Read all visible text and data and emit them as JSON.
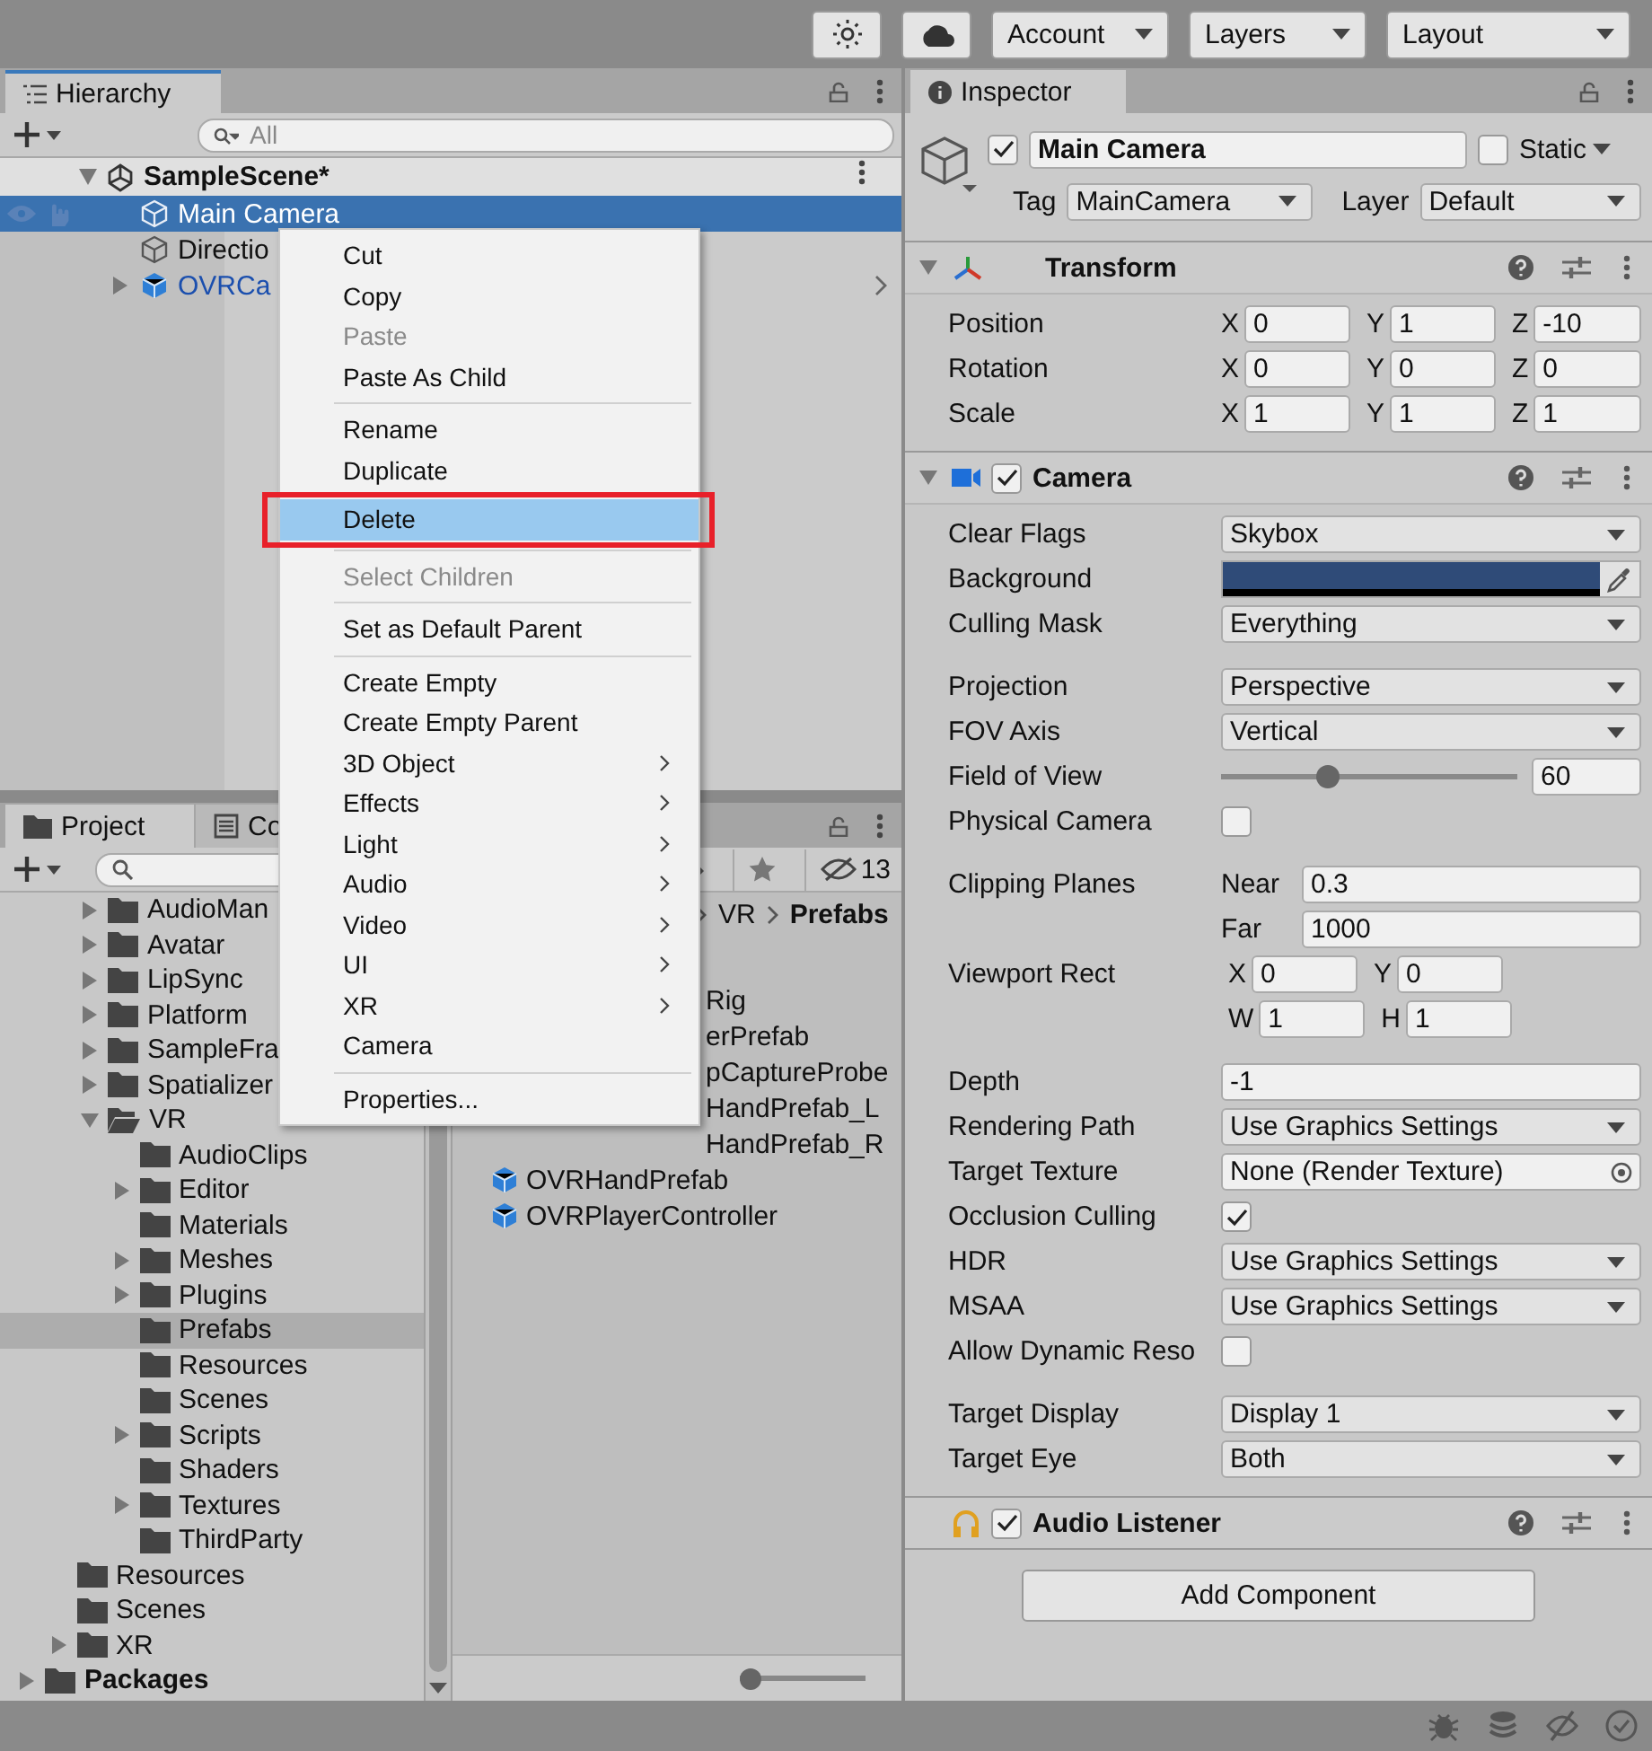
{
  "toolbar": {
    "dropdowns": [
      "Account",
      "Layers",
      "Layout"
    ]
  },
  "hierarchy": {
    "tab": "Hierarchy",
    "search_placeholder": "All",
    "scene": "SampleScene*",
    "items": [
      {
        "name": "Main Camera",
        "kind": "object",
        "selected": true,
        "expandable": false
      },
      {
        "name": "Directio",
        "kind": "object",
        "selected": false,
        "expandable": false
      },
      {
        "name": "OVRCa",
        "kind": "prefab",
        "selected": false,
        "expandable": true
      }
    ]
  },
  "context_menu": [
    [
      {
        "label": "Cut",
        "disabled": false,
        "submenu": false,
        "selected": false
      },
      {
        "label": "Copy",
        "disabled": false,
        "submenu": false,
        "selected": false
      },
      {
        "label": "Paste",
        "disabled": true,
        "submenu": false,
        "selected": false
      },
      {
        "label": "Paste As Child",
        "disabled": false,
        "submenu": false,
        "selected": false
      }
    ],
    [
      {
        "label": "Rename",
        "disabled": false,
        "submenu": false,
        "selected": false
      },
      {
        "label": "Duplicate",
        "disabled": false,
        "submenu": false,
        "selected": false
      },
      {
        "label": "Delete",
        "disabled": false,
        "submenu": false,
        "selected": true
      }
    ],
    [
      {
        "label": "Select Children",
        "disabled": true,
        "submenu": false,
        "selected": false
      }
    ],
    [
      {
        "label": "Set as Default Parent",
        "disabled": false,
        "submenu": false,
        "selected": false
      }
    ],
    [
      {
        "label": "Create Empty",
        "disabled": false,
        "submenu": false,
        "selected": false
      },
      {
        "label": "Create Empty Parent",
        "disabled": false,
        "submenu": false,
        "selected": false
      },
      {
        "label": "3D Object",
        "disabled": false,
        "submenu": true,
        "selected": false
      },
      {
        "label": "Effects",
        "disabled": false,
        "submenu": true,
        "selected": false
      },
      {
        "label": "Light",
        "disabled": false,
        "submenu": true,
        "selected": false
      },
      {
        "label": "Audio",
        "disabled": false,
        "submenu": true,
        "selected": false
      },
      {
        "label": "Video",
        "disabled": false,
        "submenu": true,
        "selected": false
      },
      {
        "label": "UI",
        "disabled": false,
        "submenu": true,
        "selected": false
      },
      {
        "label": "XR",
        "disabled": false,
        "submenu": true,
        "selected": false
      },
      {
        "label": "Camera",
        "disabled": false,
        "submenu": false,
        "selected": false
      }
    ],
    [
      {
        "label": "Properties...",
        "disabled": false,
        "submenu": false,
        "selected": false
      }
    ]
  ],
  "project": {
    "tabs": [
      {
        "label": "Project",
        "selected": true
      },
      {
        "label": "Co",
        "selected": false
      }
    ],
    "hidden_count": "13",
    "tree": [
      {
        "children": [
          {
            "children": [
              {
                "name": "AudioMan",
                "expandable": true,
                "expanded": false,
                "selected": false
              },
              {
                "name": "Avatar",
                "expandable": true,
                "expanded": false,
                "selected": false
              },
              {
                "name": "LipSync",
                "expandable": true,
                "expanded": false,
                "selected": false
              },
              {
                "name": "Platform",
                "expandable": true,
                "expanded": false,
                "selected": false
              },
              {
                "name": "SampleFra",
                "expandable": true,
                "expanded": false,
                "selected": false
              },
              {
                "name": "Spatializer",
                "expandable": true,
                "expanded": false,
                "selected": false
              },
              {
                "name": "VR",
                "expandable": true,
                "expanded": true,
                "selected": false,
                "children": [
                  {
                    "name": "AudioClips",
                    "expandable": false,
                    "expanded": false,
                    "selected": false
                  },
                  {
                    "name": "Editor",
                    "expandable": true,
                    "expanded": false,
                    "selected": false
                  },
                  {
                    "name": "Materials",
                    "expandable": false,
                    "expanded": false,
                    "selected": false
                  },
                  {
                    "name": "Meshes",
                    "expandable": true,
                    "expanded": false,
                    "selected": false
                  },
                  {
                    "name": "Plugins",
                    "expandable": true,
                    "expanded": false,
                    "selected": false
                  },
                  {
                    "name": "Prefabs",
                    "expandable": false,
                    "expanded": false,
                    "selected": true
                  },
                  {
                    "name": "Resources",
                    "expandable": false,
                    "expanded": false,
                    "selected": false
                  },
                  {
                    "name": "Scenes",
                    "expandable": false,
                    "expanded": false,
                    "selected": false
                  },
                  {
                    "name": "Scripts",
                    "expandable": true,
                    "expanded": false,
                    "selected": false
                  },
                  {
                    "name": "Shaders",
                    "expandable": false,
                    "expanded": false,
                    "selected": false
                  },
                  {
                    "name": "Textures",
                    "expandable": true,
                    "expanded": false,
                    "selected": false
                  },
                  {
                    "name": "ThirdParty",
                    "expandable": false,
                    "expanded": false,
                    "selected": false
                  }
                ]
              }
            ]
          },
          {
            "name": "Resources",
            "expandable": false,
            "expanded": false,
            "selected": false
          },
          {
            "name": "Scenes",
            "expandable": false,
            "expanded": false,
            "selected": false
          },
          {
            "name": "XR",
            "expandable": true,
            "expanded": false,
            "selected": false
          }
        ]
      },
      {
        "name": "Packages",
        "expandable": true,
        "expanded": false,
        "selected": false
      }
    ],
    "breadcrumb": [
      "VR",
      "Prefabs"
    ],
    "assets": [
      {
        "name": "Rig",
        "kind": "cut"
      },
      {
        "name": "erPrefab",
        "kind": "cut"
      },
      {
        "name": "pCaptureProbe",
        "kind": "cut"
      },
      {
        "name": "HandPrefab_L",
        "kind": "cut"
      },
      {
        "name": "HandPrefab_R",
        "kind": "cut"
      },
      {
        "name": "OVRHandPrefab",
        "kind": "prefab"
      },
      {
        "name": "OVRPlayerController",
        "kind": "prefab"
      }
    ],
    "zoom": {
      "level": 0
    }
  },
  "inspector": {
    "tab": "Inspector",
    "object": {
      "name": "Main Camera",
      "active": true,
      "static": false,
      "static_label": "Static",
      "tag_label": "Tag",
      "tag": "MainCamera",
      "layer_label": "Layer",
      "layer": "Default"
    },
    "components": [
      {
        "title": "Transform",
        "kind": "transform",
        "groups": [
          [
            {
              "label": "Position",
              "kind": "vector3",
              "fields": [
                {
                  "label": "X",
                  "value": "0"
                },
                {
                  "label": "Y",
                  "value": "1"
                },
                {
                  "label": "Z",
                  "value": "-10"
                }
              ]
            },
            {
              "label": "Rotation",
              "kind": "vector3",
              "fields": [
                {
                  "label": "X",
                  "value": "0"
                },
                {
                  "label": "Y",
                  "value": "0"
                },
                {
                  "label": "Z",
                  "value": "0"
                }
              ]
            },
            {
              "label": "Scale",
              "kind": "vector3",
              "fields": [
                {
                  "label": "X",
                  "value": "1"
                },
                {
                  "label": "Y",
                  "value": "1"
                },
                {
                  "label": "Z",
                  "value": "1"
                }
              ]
            }
          ]
        ]
      },
      {
        "title": "Camera",
        "kind": "camera",
        "enabled": true,
        "groups": [
          [
            {
              "label": "Clear Flags",
              "kind": "dropdown",
              "value": "Skybox"
            },
            {
              "label": "Background",
              "kind": "color",
              "color": "#2f4b78"
            },
            {
              "label": "Culling Mask",
              "kind": "dropdown",
              "value": "Everything"
            }
          ],
          [
            {
              "label": "Projection",
              "kind": "dropdown",
              "value": "Perspective"
            },
            {
              "label": "FOV Axis",
              "kind": "dropdown",
              "value": "Vertical"
            },
            {
              "label": "Field of View",
              "kind": "slider",
              "level": 0.35,
              "value": "60"
            },
            {
              "label": "Physical Camera",
              "kind": "checkbox",
              "checked": false
            }
          ],
          [
            {
              "label": "Clipping Planes",
              "kind": "labeled",
              "fields": [
                {
                  "label": "Near",
                  "value": "0.3"
                }
              ]
            },
            {
              "kind": "labeled",
              "fields": [
                {
                  "label": "Far",
                  "value": "1000"
                }
              ]
            },
            {
              "label": "Viewport Rect",
              "kind": "vector2",
              "fields": [
                {
                  "label": "X",
                  "value": "0"
                },
                {
                  "label": "Y",
                  "value": "0"
                }
              ]
            },
            {
              "kind": "vector2",
              "fields": [
                {
                  "label": "W",
                  "value": "1"
                },
                {
                  "label": "H",
                  "value": "1"
                }
              ]
            }
          ],
          [
            {
              "label": "Depth",
              "kind": "number",
              "value": "-1"
            },
            {
              "label": "Rendering Path",
              "kind": "dropdown",
              "value": "Use Graphics Settings"
            },
            {
              "label": "Target Texture",
              "kind": "object",
              "value": "None (Render Texture)"
            },
            {
              "label": "Occlusion Culling",
              "kind": "checkbox",
              "checked": true
            },
            {
              "label": "HDR",
              "kind": "dropdown",
              "value": "Use Graphics Settings"
            },
            {
              "label": "MSAA",
              "kind": "dropdown",
              "value": "Use Graphics Settings"
            },
            {
              "label": "Allow Dynamic Reso",
              "kind": "checkbox",
              "checked": false
            }
          ],
          [
            {
              "label": "Target Display",
              "kind": "dropdown",
              "value": "Display 1"
            },
            {
              "label": "Target Eye",
              "kind": "dropdown",
              "value": "Both"
            }
          ]
        ]
      },
      {
        "title": "Audio Listener",
        "kind": "audio",
        "enabled": true
      }
    ],
    "add_button": "Add Component"
  }
}
